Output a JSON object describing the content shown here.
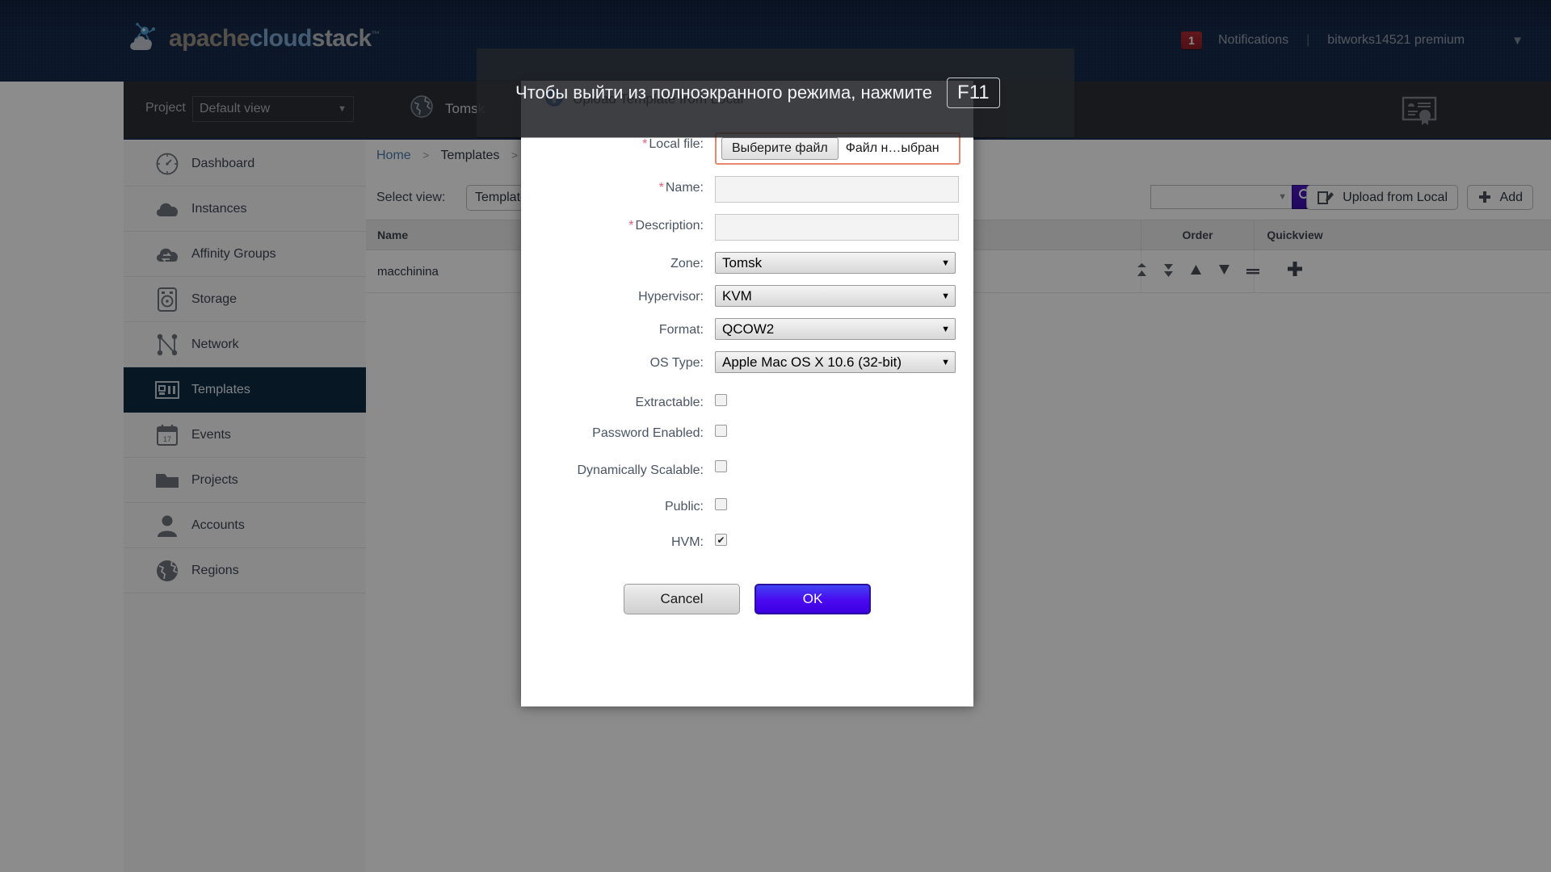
{
  "brand": {
    "part_a": "apache",
    "part_b": "cloud",
    "part_c": "stack",
    "tm": "™"
  },
  "header": {
    "notification_count": "1",
    "notifications_label": "Notifications",
    "separator": "|",
    "user": "bitworks14521 premium",
    "caret": "▼"
  },
  "projectbar": {
    "project_label": "Project",
    "project_value": "Default view",
    "caret": "▼",
    "zone": "Tomsk"
  },
  "sidebar": {
    "items": [
      {
        "label": "Dashboard",
        "icon": "gauge-icon",
        "active": false
      },
      {
        "label": "Instances",
        "icon": "cloud-icon",
        "active": false
      },
      {
        "label": "Affinity Groups",
        "icon": "cloud-swap-icon",
        "active": false
      },
      {
        "label": "Storage",
        "icon": "disk-icon",
        "active": false
      },
      {
        "label": "Network",
        "icon": "network-icon",
        "active": false
      },
      {
        "label": "Templates",
        "icon": "templates-icon",
        "active": true
      },
      {
        "label": "Events",
        "icon": "calendar-icon",
        "active": false
      },
      {
        "label": "Projects",
        "icon": "folder-icon",
        "active": false
      },
      {
        "label": "Accounts",
        "icon": "user-icon",
        "active": false
      },
      {
        "label": "Regions",
        "icon": "globe-icon",
        "active": false
      }
    ]
  },
  "breadcrumb": {
    "home": "Home",
    "sep": ">",
    "current": "Templates",
    "sep2": ">"
  },
  "toolbar": {
    "select_view_label": "Select view:",
    "select_view_value": "Templates",
    "search_placeholder": "",
    "search_caret": "▼",
    "upload_label": "Upload from Local",
    "add_label": "Add"
  },
  "table": {
    "columns": [
      "Name",
      "Order",
      "Quickview"
    ],
    "rows": [
      {
        "name": "macchinina",
        "order_actions": [
          "move-to-top",
          "move-to-bottom",
          "move-up",
          "move-down",
          "drag-handle"
        ],
        "quickview": "+"
      }
    ]
  },
  "fullscreen_hint": {
    "message": "Чтобы выйти из полноэкранного режима, нажмите",
    "key": "F11"
  },
  "dialog": {
    "title": "Upload Template from Local",
    "fields": {
      "local_file": {
        "label": "Local file:",
        "required": "*",
        "button": "Выберите файл",
        "filename": "Файл н…ыбран"
      },
      "name": {
        "label": "Name:",
        "required": "*",
        "value": ""
      },
      "description": {
        "label": "Description:",
        "required": "*",
        "value": ""
      },
      "zone": {
        "label": "Zone:",
        "value": "Tomsk",
        "caret": "▼"
      },
      "hypervisor": {
        "label": "Hypervisor:",
        "value": "KVM",
        "caret": "▼"
      },
      "format": {
        "label": "Format:",
        "value": "QCOW2",
        "caret": "▼"
      },
      "os_type": {
        "label": "OS Type:",
        "value": "Apple Mac OS X 10.6 (32-bit)",
        "caret": "▼"
      },
      "extractable": {
        "label": "Extractable:",
        "checked": false,
        "mark": ""
      },
      "password_enabled": {
        "label": "Password Enabled:",
        "checked": false,
        "mark": ""
      },
      "dynamically_scalable": {
        "label": "Dynamically Scalable:",
        "checked": false,
        "mark": ""
      },
      "public": {
        "label": "Public:",
        "checked": false,
        "mark": ""
      },
      "hvm": {
        "label": "HVM:",
        "checked": true,
        "mark": "✔"
      }
    },
    "buttons": {
      "cancel": "Cancel",
      "ok": "OK"
    }
  },
  "colors": {
    "brand_dark": "#152a4c",
    "accent_blue": "#0d2a42",
    "ok_button": "#4b08f0",
    "required_star": "#e8607a",
    "file_outline": "#e8866d",
    "notification_badge": "#b02a33"
  }
}
